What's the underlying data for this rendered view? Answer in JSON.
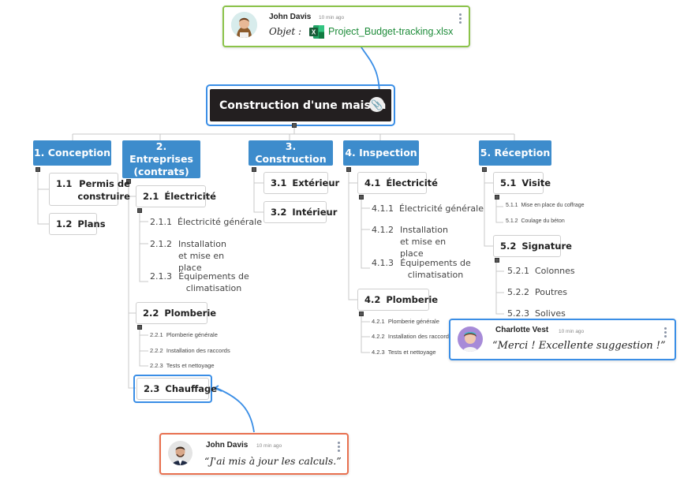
{
  "root": {
    "title": "Construction d'une maison",
    "attachment_icon": "paperclip-icon"
  },
  "branches": [
    {
      "label": "1.  Conception",
      "children": [
        {
          "num": "1.1",
          "label": "Permis de construire"
        },
        {
          "num": "1.2",
          "label": "Plans"
        }
      ]
    },
    {
      "label": "2.  Entreprises (contrats)",
      "children": [
        {
          "num": "2.1",
          "label": "Électricité",
          "children": [
            {
              "num": "2.1.1",
              "label": "Électricité générale"
            },
            {
              "num": "2.1.2",
              "label": "Installation et mise en place"
            },
            {
              "num": "2.1.3",
              "label": "Équipements de climatisation"
            }
          ]
        },
        {
          "num": "2.2",
          "label": "Plomberie",
          "children": [
            {
              "num": "2.2.1",
              "label": "Plomberie générale"
            },
            {
              "num": "2.2.2",
              "label": "Installation des raccords"
            },
            {
              "num": "2.2.3",
              "label": "Tests et nettoyage"
            }
          ]
        },
        {
          "num": "2.3",
          "label": "Chauffage"
        }
      ]
    },
    {
      "label": "3.  Construction",
      "children": [
        {
          "num": "3.1",
          "label": "Extérieur"
        },
        {
          "num": "3.2",
          "label": "Intérieur"
        }
      ]
    },
    {
      "label": "4.  Inspection",
      "children": [
        {
          "num": "4.1",
          "label": "Électricité",
          "children": [
            {
              "num": "4.1.1",
              "label": "Électricité générale"
            },
            {
              "num": "4.1.2",
              "label": "Installation et mise en place"
            },
            {
              "num": "4.1.3",
              "label": "Équipements de climatisation"
            }
          ]
        },
        {
          "num": "4.2",
          "label": "Plomberie",
          "children": [
            {
              "num": "4.2.1",
              "label": "Plomberie générale"
            },
            {
              "num": "4.2.2",
              "label": "Installation des raccords"
            },
            {
              "num": "4.2.3",
              "label": "Tests et nettoyage"
            }
          ]
        }
      ]
    },
    {
      "label": "5.  Réception",
      "children": [
        {
          "num": "5.1",
          "label": "Visite",
          "children": [
            {
              "num": "5.1.1",
              "label": "Mise en place du coffrage"
            },
            {
              "num": "5.1.2",
              "label": "Coulage du béton"
            }
          ]
        },
        {
          "num": "5.2",
          "label": "Signature",
          "children": [
            {
              "num": "5.2.1",
              "label": "Colonnes"
            },
            {
              "num": "5.2.2",
              "label": "Poutres"
            },
            {
              "num": "5.2.3",
              "label": "Solives"
            }
          ]
        }
      ]
    }
  ],
  "comments": {
    "top": {
      "author": "John Davis",
      "time": "10 min ago",
      "prefix": "Objet :",
      "file": "Project_Budget-tracking.xlsx",
      "file_icon": "excel-icon",
      "border": "#8bc34a"
    },
    "right": {
      "author": "Charlotte Vest",
      "time": "10 min ago",
      "text": "“Merci ! Excellente suggestion !”",
      "border": "#3a8ee6"
    },
    "bottom": {
      "author": "John Davis",
      "time": "10 min ago",
      "text": "“J'ai mis à jour les calculs.”",
      "border": "#e8704f"
    }
  },
  "colors": {
    "branch": "#3d8ccc",
    "root": "#231f20",
    "highlight": "#3a8ee6",
    "file_link": "#1e8c3a"
  }
}
